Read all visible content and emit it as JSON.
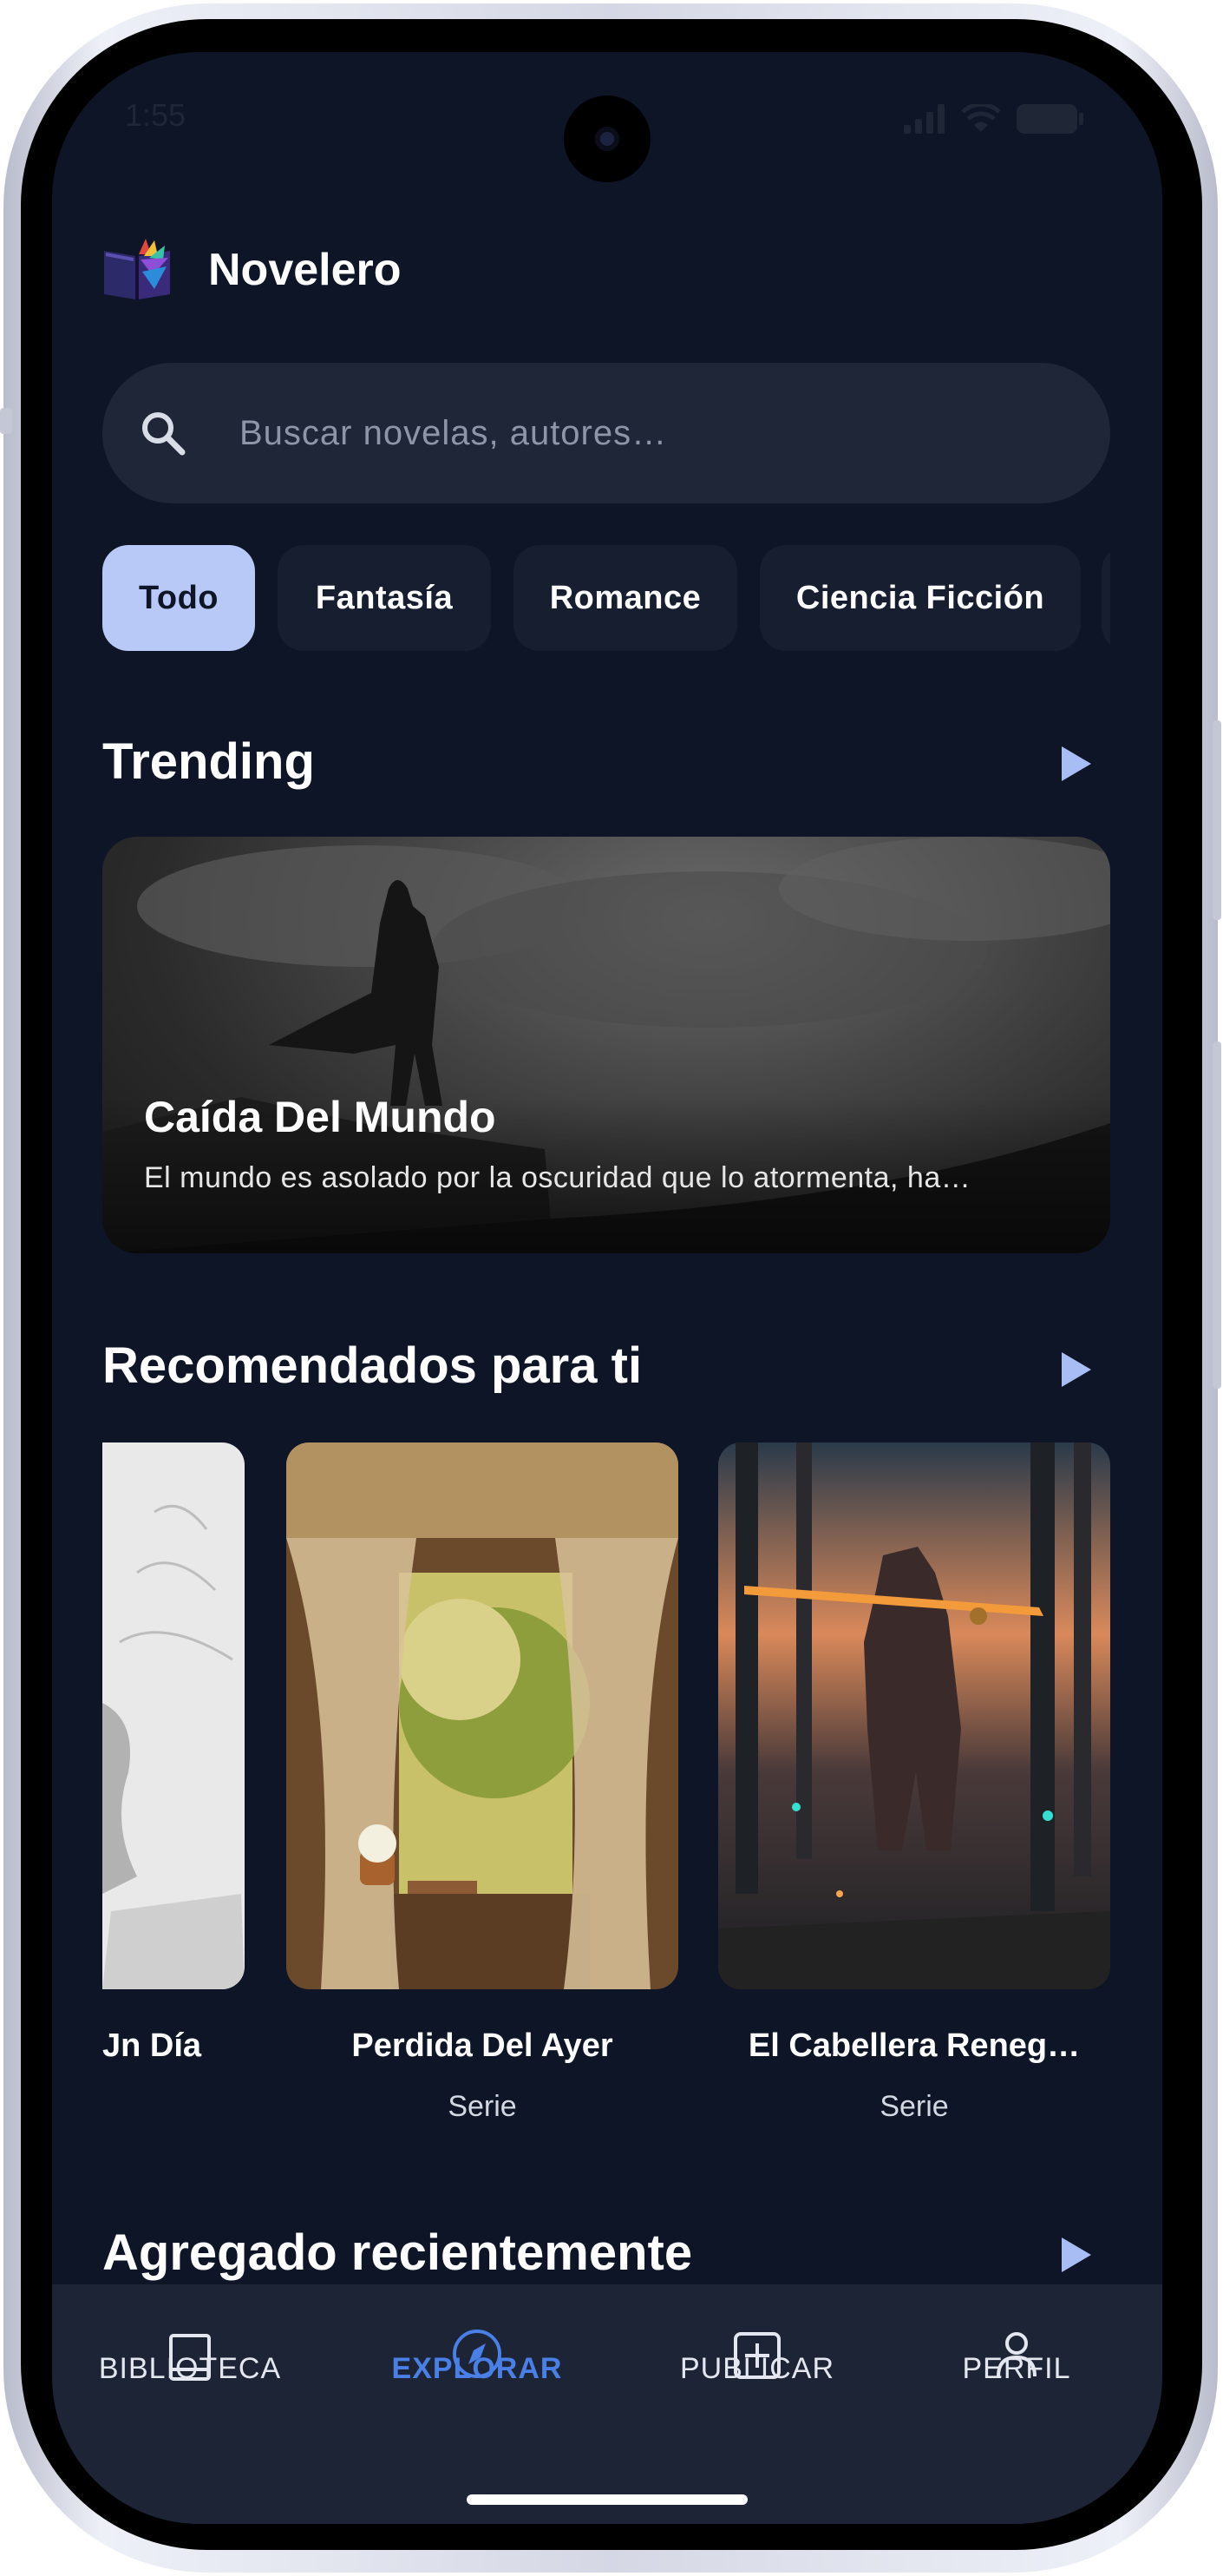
{
  "status_bar": {
    "time": "1:55"
  },
  "app": {
    "title": "Novelero"
  },
  "search": {
    "placeholder": "Buscar novelas, autores…"
  },
  "categories": [
    {
      "label": "Todo",
      "active": true
    },
    {
      "label": "Fantasía",
      "active": false
    },
    {
      "label": "Romance",
      "active": false
    },
    {
      "label": "Ciencia Ficción",
      "active": false
    }
  ],
  "sections": {
    "trending": "Trending",
    "recommended": "Recomendados para ti",
    "recent": "Agregado recientemente"
  },
  "trending_card": {
    "title": "Caída Del Mundo",
    "description": "El mundo es asolado por la oscuridad que lo atormenta, ha…"
  },
  "recommended": [
    {
      "title": "Jn Día",
      "subtitle": ""
    },
    {
      "title": "Perdida Del Ayer",
      "subtitle": "Serie"
    },
    {
      "title": "El Cabellera Reneg…",
      "subtitle": "Serie"
    }
  ],
  "nav": {
    "library": "BIBLIOTECA",
    "explore": "EXPLORAR",
    "publish": "PUBLICAR",
    "profile": "PERFIL"
  },
  "colors": {
    "background": "#0d1527",
    "accent": "#4a7fe6",
    "chip_active": "#b8c8f7"
  }
}
